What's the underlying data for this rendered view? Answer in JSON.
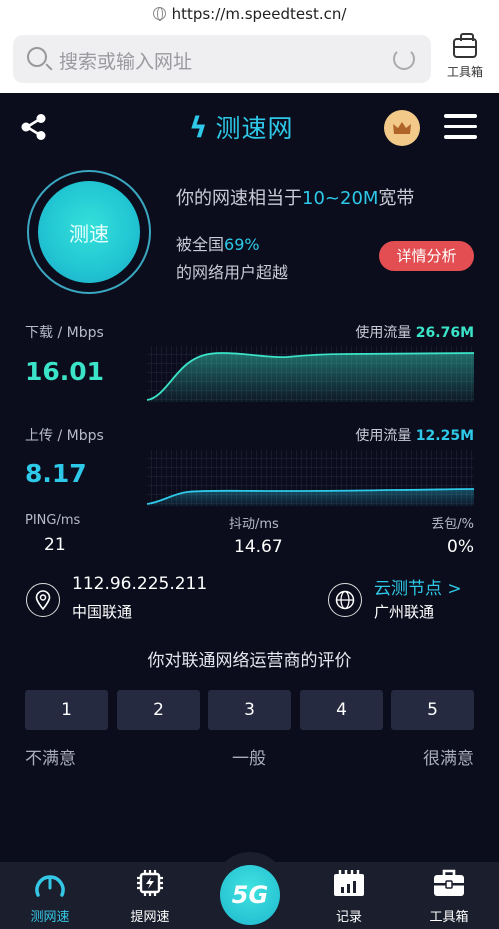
{
  "browser": {
    "url": "https://m.speedtest.cn/",
    "search_placeholder": "搜索或输入网址",
    "toolbox_label": "工具箱"
  },
  "header": {
    "logo_mark": "ϟ",
    "app_name": "测速网"
  },
  "test": {
    "start_label": "测速",
    "summary_prefix": "你的网速相当于",
    "summary_band": "10~20M",
    "summary_suffix": "宽带",
    "rank_prefix": "被全国",
    "rank_percent": "69%",
    "rank_suffix": "的网络用户超越",
    "detail_button": "详情分析"
  },
  "download": {
    "label": "下载 / Mbps",
    "value": "16.01",
    "usage_label": "使用流量",
    "usage_value": "26.76M",
    "color": "#3be3c8"
  },
  "upload": {
    "label": "上传 / Mbps",
    "value": "8.17",
    "usage_label": "使用流量",
    "usage_value": "12.25M",
    "color": "#2ec9e8"
  },
  "stats": {
    "ping_label": "PING/ms",
    "ping_value": "21",
    "jitter_label": "抖动/ms",
    "jitter_value": "14.67",
    "loss_label": "丢包/%",
    "loss_value": "0%"
  },
  "location": {
    "ip": "112.96.225.211",
    "isp": "中国联通",
    "node_link": "云测节点 >",
    "node_name": "广州联通"
  },
  "rating": {
    "title": "你对联通网络运营商的评价",
    "options": [
      "1",
      "2",
      "3",
      "4",
      "5"
    ],
    "low": "不满意",
    "mid": "一般",
    "high": "很满意"
  },
  "nav": {
    "speed": "测网速",
    "boost": "提网速",
    "fab": "5G",
    "records": "记录",
    "tools": "工具箱"
  }
}
